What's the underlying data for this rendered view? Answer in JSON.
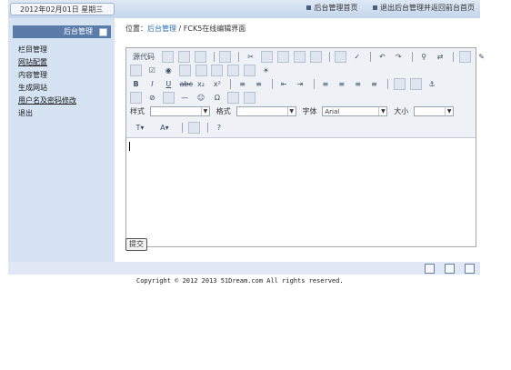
{
  "header": {
    "date_text": "2012年02月01日 星期三",
    "links": [
      "后台管理首页",
      "退出后台管理并返回前台首页"
    ]
  },
  "sidebar": {
    "title": "后台管理",
    "items": [
      {
        "label": "栏目管理",
        "underline": false
      },
      {
        "label": "网站配置",
        "underline": true
      },
      {
        "label": "内容管理",
        "underline": false
      },
      {
        "label": "生成网站",
        "underline": false
      },
      {
        "label": "用户名及密码修改",
        "underline": true
      },
      {
        "label": "退出",
        "underline": false
      }
    ]
  },
  "breadcrumb": {
    "prefix": "位置：",
    "link": "后台管理",
    "separator": " / ",
    "current": "FCK5在线编辑界面"
  },
  "editor": {
    "source_label": "源代码",
    "style_label": "样式",
    "format_label": "格式",
    "font_label": "字体",
    "font_value": "Arial",
    "size_label": "大小",
    "style_value": "",
    "format_value": "",
    "size_value": ""
  },
  "form": {
    "submit_label": "提交"
  },
  "footer": {
    "copyright": "Copyright © 2012 2013 51Dream.com  All rights reserved."
  }
}
